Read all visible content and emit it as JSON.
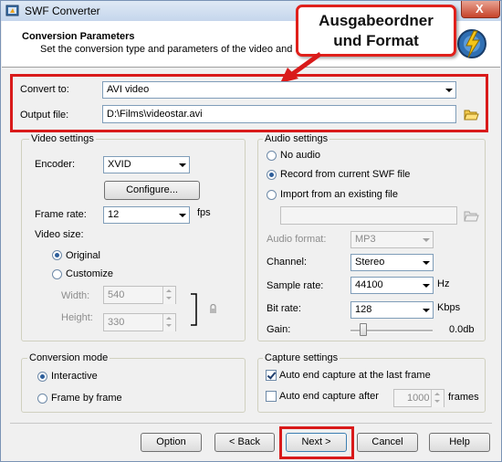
{
  "window": {
    "title": "SWF Converter",
    "close_glyph": "X"
  },
  "header": {
    "title": "Conversion Parameters",
    "subtitle": "Set the conversion type and parameters of the video and audio"
  },
  "callout": {
    "line1": "Ausgabeordner",
    "line2": "und Format"
  },
  "convert": {
    "convert_to_label": "Convert to:",
    "convert_to_value": "AVI video",
    "output_file_label": "Output file:",
    "output_file_value": "D:\\Films\\videostar.avi"
  },
  "video": {
    "group_label": "Video settings",
    "encoder_label": "Encoder:",
    "encoder_value": "XVID",
    "configure_label": "Configure...",
    "frame_rate_label": "Frame rate:",
    "frame_rate_value": "12",
    "frame_rate_unit": "fps",
    "video_size_label": "Video size:",
    "original_label": "Original",
    "customize_label": "Customize",
    "width_label": "Width:",
    "width_value": "540",
    "height_label": "Height:",
    "height_value": "330"
  },
  "audio": {
    "group_label": "Audio settings",
    "no_audio_label": "No audio",
    "record_label": "Record from current SWF file",
    "import_label": "Import from an existing file",
    "import_path_value": "",
    "audio_format_label": "Audio format:",
    "audio_format_value": "MP3",
    "channel_label": "Channel:",
    "channel_value": "Stereo",
    "sample_rate_label": "Sample rate:",
    "sample_rate_value": "44100",
    "sample_rate_unit": "Hz",
    "bit_rate_label": "Bit rate:",
    "bit_rate_value": "128",
    "bit_rate_unit": "Kbps",
    "gain_label": "Gain:",
    "gain_value": "0.0db"
  },
  "conversion_mode": {
    "group_label": "Conversion mode",
    "interactive_label": "Interactive",
    "frame_by_frame_label": "Frame by frame"
  },
  "capture": {
    "group_label": "Capture settings",
    "auto_end_last_label": "Auto end capture at the last frame",
    "auto_end_after_label": "Auto end capture after",
    "frames_value": "1000",
    "frames_unit": "frames"
  },
  "buttons": {
    "option": "Option",
    "back": "< Back",
    "next": "Next >",
    "cancel": "Cancel",
    "help": "Help"
  },
  "colors": {
    "highlight": "#d91a1a",
    "accent": "#2d5e9a"
  }
}
